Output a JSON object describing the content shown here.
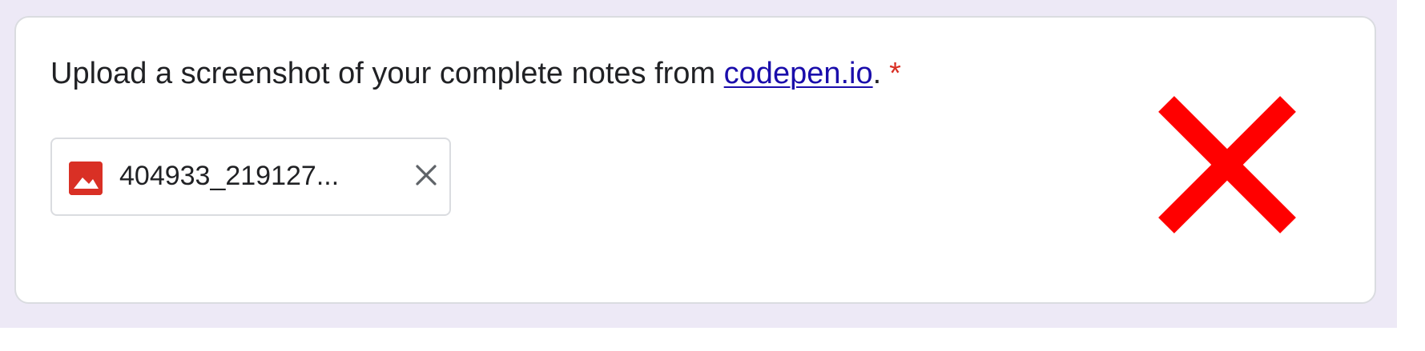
{
  "question": {
    "text_before_link": "Upload a screenshot of your complete notes from ",
    "link_text": "codepen.io",
    "text_after_link": ".",
    "required_marker": "*"
  },
  "uploaded_file": {
    "name": "404933_219127...",
    "icon": "image-file-icon",
    "remove_icon": "close-icon"
  },
  "overlay_mark": {
    "icon": "red-x-mark-icon",
    "color": "#ff0000"
  },
  "colors": {
    "page_background": "#ede9f6",
    "card_background": "#ffffff",
    "card_border": "#dadce0",
    "link": "#1a0dab",
    "required": "#d93025",
    "file_icon": "#d93025"
  }
}
